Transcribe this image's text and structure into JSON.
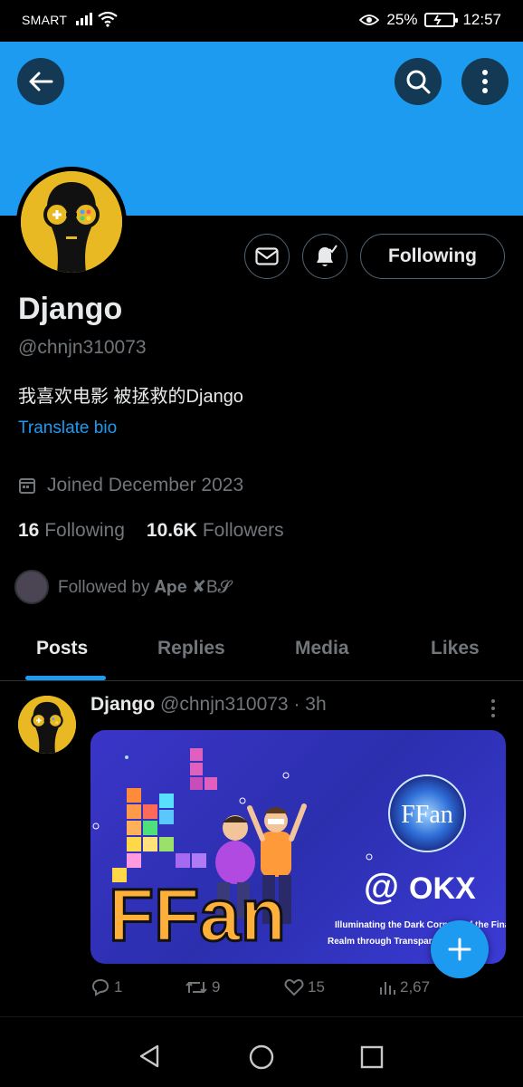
{
  "status_bar": {
    "carrier": "SMART",
    "battery": "25%",
    "time": "12:57"
  },
  "profile": {
    "name": "Django",
    "handle": "@chnjn310073",
    "bio": "我喜欢电影 被拯救的Django",
    "translate_label": "Translate bio",
    "joined": "Joined December 2023",
    "following_count": "16",
    "following_label": "Following",
    "followers_count": "10.6K",
    "followers_label": "Followers",
    "followed_by": "Followed by 𝐀𝐩𝐞 ✘B𝓢"
  },
  "actions": {
    "following_button": "Following"
  },
  "tabs": [
    {
      "label": "Posts",
      "active": true
    },
    {
      "label": "Replies",
      "active": false
    },
    {
      "label": "Media",
      "active": false
    },
    {
      "label": "Likes",
      "active": false
    }
  ],
  "post": {
    "author": "Django",
    "meta": "@chnjn310073 · 3h",
    "media": {
      "title": "FFan",
      "badge": "FFan",
      "brand": "OKX",
      "at": "@",
      "caption_line1": "Illuminating the Dark Corners of the Financial",
      "caption_line2": "Realm through Transparent..."
    },
    "replies": "1",
    "reposts": "9",
    "likes": "15",
    "views": "2,67"
  },
  "colors": {
    "accent": "#1d9bf0",
    "background": "#000000",
    "muted": "#71767b",
    "text": "#e7e9ea"
  }
}
